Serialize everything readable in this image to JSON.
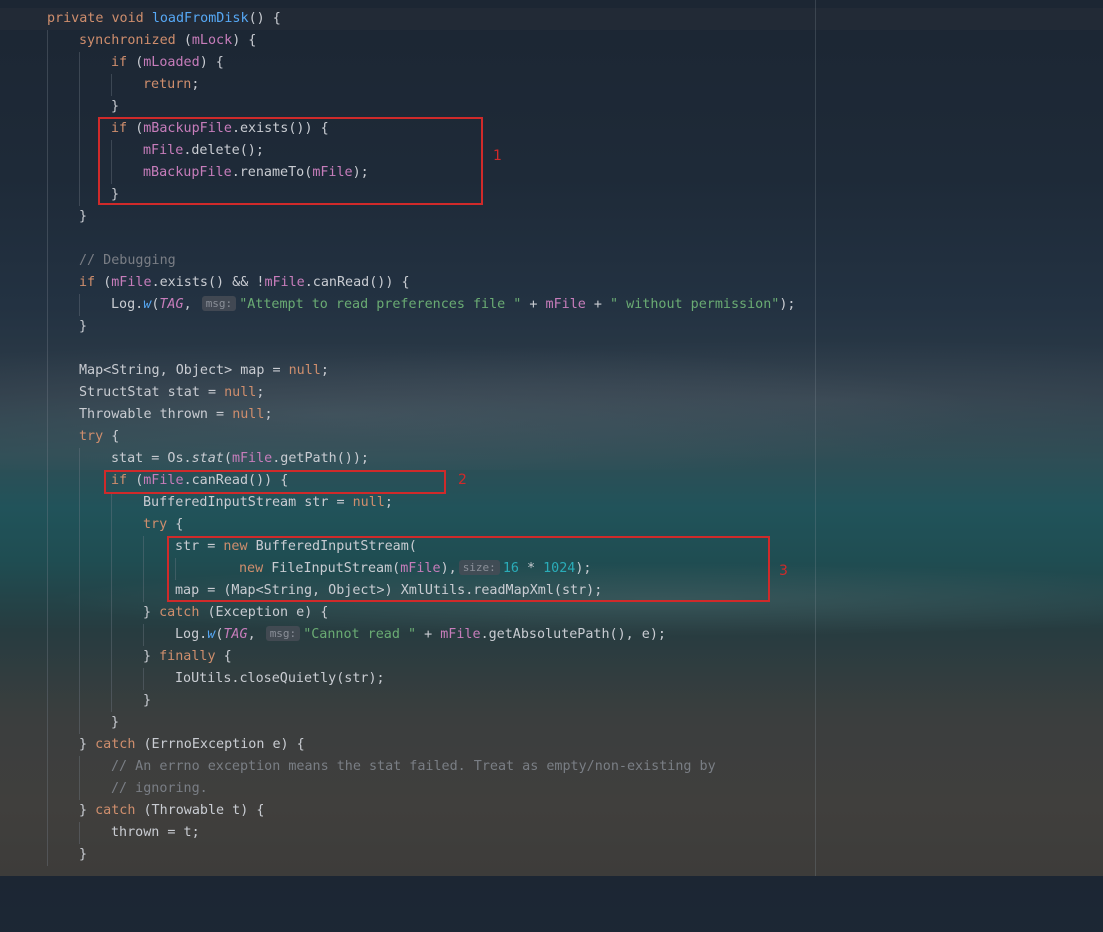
{
  "editor": {
    "annotations": {
      "box1_label": "1",
      "box2_label": "2",
      "box3_label": "3",
      "box_color": "#d02a2a"
    },
    "lines": {
      "l1": {
        "a": "private void ",
        "b": "loadFromDisk",
        "c": "() {"
      },
      "l2": {
        "a": "synchronized ",
        "b": "(",
        "c": "mLock",
        "d": ") {"
      },
      "l3": {
        "a": "if ",
        "b": "(",
        "c": "mLoaded",
        "d": ") {"
      },
      "l4": {
        "a": "return",
        "b": ";"
      },
      "l5": {
        "a": "}"
      },
      "l6": {
        "a": "if ",
        "b": "(",
        "c": "mBackupFile",
        "d": ".exists()) {"
      },
      "l7": {
        "a": "mFile",
        "b": ".delete();"
      },
      "l8": {
        "a": "mBackupFile",
        "b": ".renameTo(",
        "c": "mFile",
        "d": ");"
      },
      "l9": {
        "a": "}"
      },
      "l10": {
        "a": "}"
      },
      "l11": {
        "a": "// Debugging"
      },
      "l12": {
        "a": "if ",
        "b": "(",
        "c": "mFile",
        "d": ".exists() && !",
        "e": "mFile",
        "f": ".canRead()) {"
      },
      "l13": {
        "a": "Log.",
        "b": "w",
        "c": "(",
        "d": "TAG",
        ",e": ", ",
        "hint": "msg:",
        "s": "\"Attempt to read preferences file \"",
        "g": " + ",
        "h": "mFile",
        "i": " + ",
        "j": "\" without permission\"",
        "k": ");"
      },
      "l14": {
        "a": "}"
      },
      "l15": {
        "a": "Map<String, Object> map = ",
        "b": "null",
        ",c": ";"
      },
      "l16": {
        "a": "StructStat stat = ",
        "b": "null",
        "c": ";"
      },
      "l17": {
        "a": "Throwable thrown = ",
        "b": "null",
        "c": ";"
      },
      "l18": {
        "a": "try ",
        "b": "{"
      },
      "l19": {
        "a": "stat = Os.",
        "b": "stat",
        "c": "(",
        "d": "mFile",
        "e": ".getPath());"
      },
      "l20": {
        "a": "if ",
        "b": "(",
        "c": "mFile",
        "d": ".canRead()) {"
      },
      "l21": {
        "a": "BufferedInputStream str = ",
        "b": "null",
        "c": ";"
      },
      "l22": {
        "a": "try ",
        "b": "{"
      },
      "l23": {
        "a": "str = ",
        "b": "new ",
        "c": "BufferedInputStream("
      },
      "l24": {
        "a": "new ",
        "b": "FileInputStream(",
        "c": "mFile",
        "d": "),",
        "hint": "size:",
        "e": "16",
        "f": " * ",
        "g": "1024",
        "h": ");"
      },
      "l25": {
        "a": "map = (Map<String, Object>) XmlUtils.readMapXml(str);"
      },
      "l26": {
        "a": "} ",
        "b": "catch ",
        "c": "(Exception e) {"
      },
      "l27": {
        "a": "Log.",
        "b": "w",
        "c": "(",
        "d": "TAG",
        "e": ", ",
        "hint": "msg:",
        "s": "\"Cannot read \"",
        "g": " + ",
        "h": "mFile",
        "i": ".getAbsolutePath(), e);"
      },
      "l28": {
        "a": "} ",
        "b": "finally ",
        "c": "{"
      },
      "l29": {
        "a": "IoUtils.closeQuietly(str);"
      },
      "l30": {
        "a": "}"
      },
      "l31": {
        "a": "}"
      },
      "l32": {
        "a": "} ",
        "b": "catch ",
        "c": "(ErrnoException e) {"
      },
      "l33": {
        "a": "// An errno exception means the stat failed. Treat as empty/non-existing by"
      },
      "l34": {
        "a": "// ignoring."
      },
      "l35": {
        "a": "} ",
        "b": "catch ",
        "c": "(Throwable t) {"
      },
      "l36": {
        "a": "thrown = t;"
      },
      "l37": {
        "a": "}"
      }
    }
  }
}
